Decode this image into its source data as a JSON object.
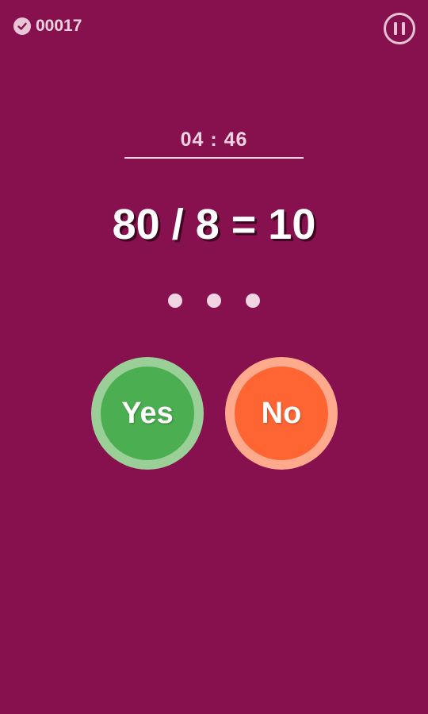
{
  "header": {
    "score": "00017",
    "score_icon": "check-circle-icon",
    "pause_icon": "pause-icon"
  },
  "timer": {
    "value": "04 : 46"
  },
  "question": {
    "equation": "80 / 8 = 10"
  },
  "progress": {
    "dots_count": 3
  },
  "answers": {
    "yes_label": "Yes",
    "no_label": "No"
  },
  "colors": {
    "background": "#87104E",
    "yes": "#4BAE50",
    "yes_ring": "#9BCF98",
    "no": "#FF6433",
    "no_ring": "#FFAA8C"
  }
}
